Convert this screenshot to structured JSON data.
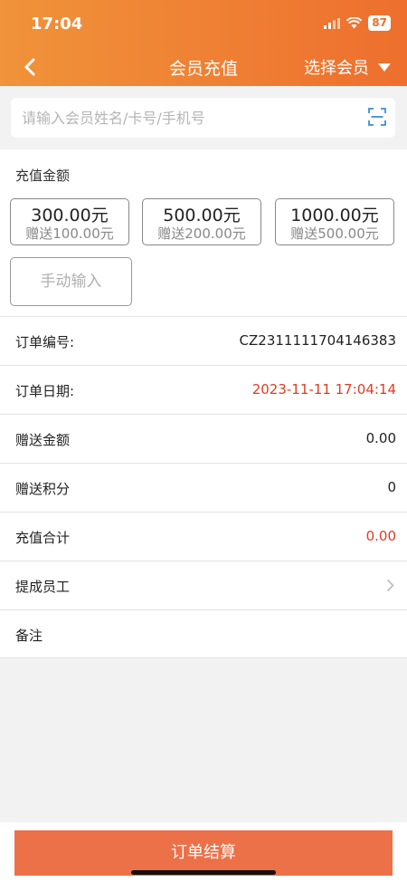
{
  "status_bar": {
    "time": "17:04",
    "battery": "87"
  },
  "nav": {
    "title": "会员充值",
    "select_member": "选择会员"
  },
  "search": {
    "placeholder": "请输入会员姓名/卡号/手机号"
  },
  "amount": {
    "title": "充值金额",
    "options": [
      {
        "amount": "300.00元",
        "gift": "赠送100.00元"
      },
      {
        "amount": "500.00元",
        "gift": "赠送200.00元"
      },
      {
        "amount": "1000.00元",
        "gift": "赠送500.00元"
      }
    ],
    "manual": "手动输入"
  },
  "order": {
    "number_label": "订单编号:",
    "number": "CZ2311111704146383",
    "date_label": "订单日期:",
    "date": "2023-11-11 17:04:14",
    "gift_amount_label": "赠送金额",
    "gift_amount": "0.00",
    "gift_points_label": "赠送积分",
    "gift_points": "0",
    "total_label": "充值合计",
    "total": "0.00",
    "staff_label": "提成员工",
    "remark_label": "备注"
  },
  "footer": {
    "submit": "订单结算"
  },
  "colors": {
    "header_start": "#f0933a",
    "header_end": "#ee6f2e",
    "accent_red": "#e23b22",
    "button": "#ec7048"
  }
}
